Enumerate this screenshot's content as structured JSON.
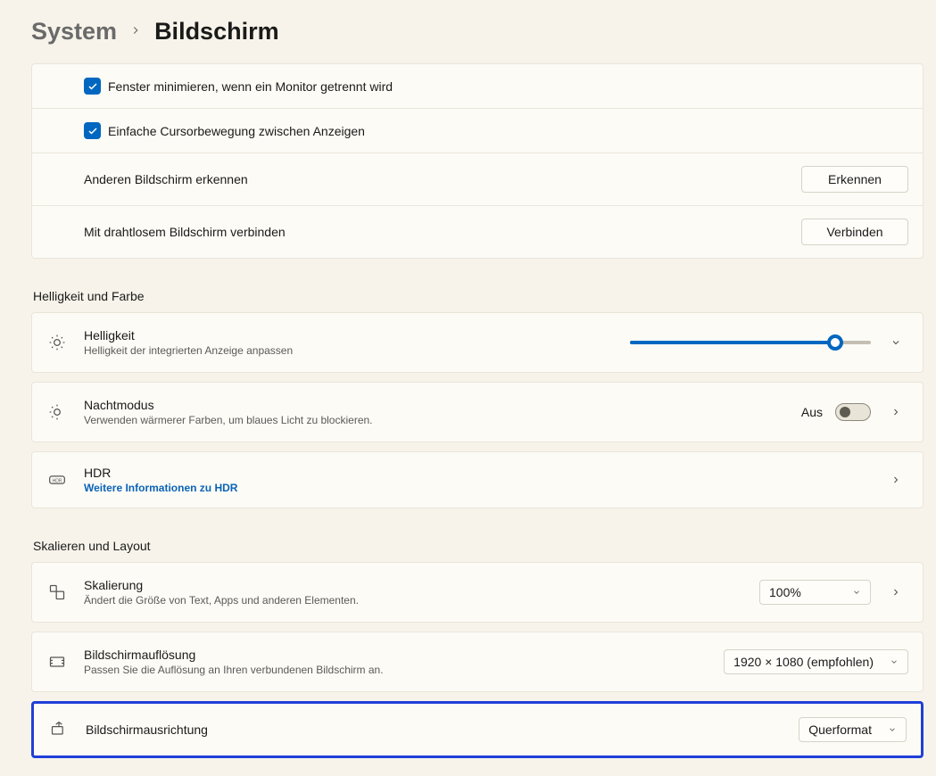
{
  "breadcrumb": {
    "parent": "System",
    "current": "Bildschirm"
  },
  "topGroup": {
    "minimize": "Fenster minimieren, wenn ein Monitor getrennt wird",
    "cursor": "Einfache Cursorbewegung zwischen Anzeigen",
    "detectTitle": "Anderen Bildschirm erkennen",
    "detectBtn": "Erkennen",
    "wirelessTitle": "Mit drahtlosem Bildschirm verbinden",
    "wirelessBtn": "Verbinden"
  },
  "sectionBrightness": "Helligkeit und Farbe",
  "brightness": {
    "title": "Helligkeit",
    "desc": "Helligkeit der integrierten Anzeige anpassen",
    "value": 85
  },
  "nightMode": {
    "title": "Nachtmodus",
    "desc": "Verwenden wärmerer Farben, um blaues Licht zu blockieren.",
    "stateLabel": "Aus"
  },
  "hdr": {
    "title": "HDR",
    "link": "Weitere Informationen zu HDR"
  },
  "sectionScale": "Skalieren und Layout",
  "scale": {
    "title": "Skalierung",
    "desc": "Ändert die Größe von Text, Apps und anderen Elementen.",
    "value": "100%"
  },
  "resolution": {
    "title": "Bildschirmauflösung",
    "desc": "Passen Sie die Auflösung an Ihren verbundenen Bildschirm an.",
    "value": "1920 × 1080 (empfohlen)"
  },
  "orientation": {
    "title": "Bildschirmausrichtung",
    "value": "Querformat"
  }
}
